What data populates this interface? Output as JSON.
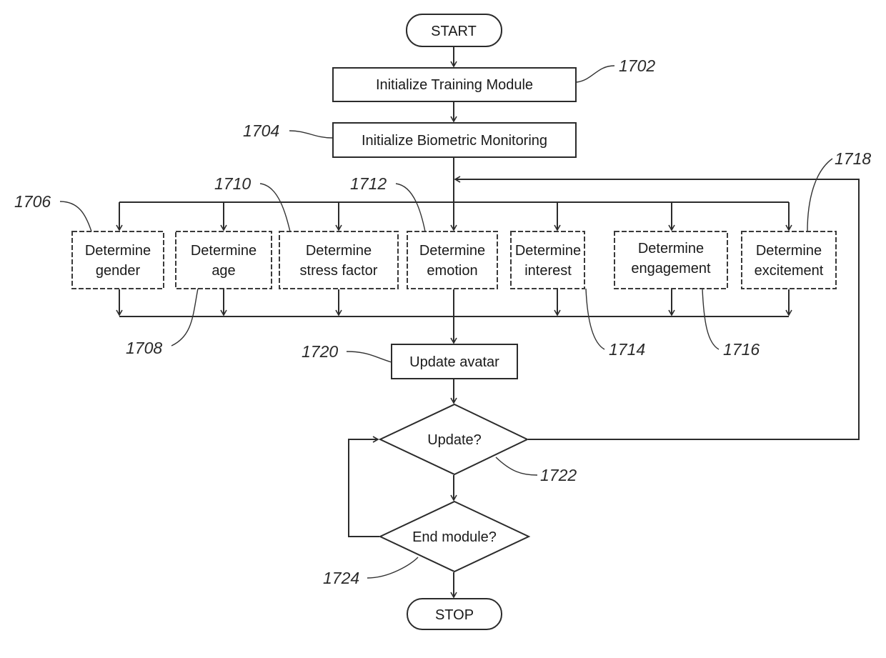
{
  "diagram": {
    "type": "flowchart",
    "terminals": {
      "start": "START",
      "stop": "STOP"
    },
    "steps": {
      "init_training": {
        "label": "Initialize Training Module",
        "ref": "1702"
      },
      "init_biometric": {
        "label": "Initialize Biometric Monitoring",
        "ref": "1704"
      },
      "update_avatar": {
        "label": "Update avatar",
        "ref": "1720"
      }
    },
    "parallel_steps": [
      {
        "line1": "Determine",
        "line2": "gender",
        "ref": "1706"
      },
      {
        "line1": "Determine",
        "line2": "age",
        "ref": "1708"
      },
      {
        "line1": "Determine",
        "line2": "stress factor",
        "ref": "1710"
      },
      {
        "line1": "Determine",
        "line2": "emotion",
        "ref": "1712"
      },
      {
        "line1": "Determine",
        "line2": "interest",
        "ref": "1714"
      },
      {
        "line1": "Determine",
        "line2": "engagement",
        "ref": "1716"
      },
      {
        "line1": "Determine",
        "line2": "excitement",
        "ref": "1718"
      }
    ],
    "decisions": {
      "update": {
        "label": "Update?",
        "ref": "1722"
      },
      "end_module": {
        "label": "End module?",
        "ref": "1724"
      }
    },
    "edges": [
      "START -> Initialize Training Module",
      "Initialize Training Module -> Initialize Biometric Monitoring",
      "Initialize Biometric Monitoring -> all Determine steps (parallel)",
      "all Determine steps -> Update avatar",
      "Update avatar -> Update?",
      "Update? (right) -> loop back above Determine steps",
      "Update? (down) -> End module?",
      "End module? (left) -> Update?",
      "End module? (down) -> STOP"
    ]
  }
}
